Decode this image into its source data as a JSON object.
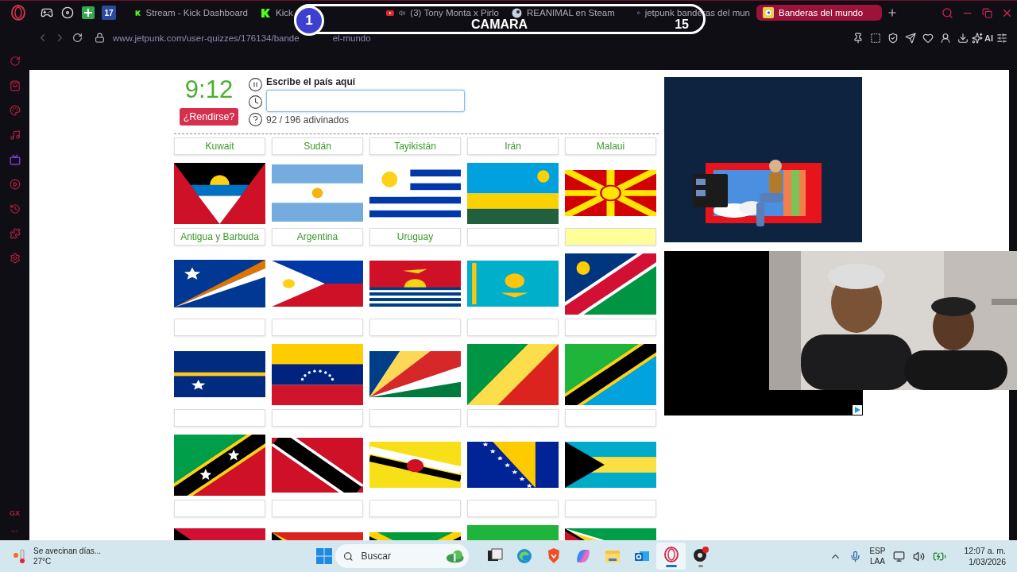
{
  "browser": {
    "pinned": [
      {
        "kind": "gamepad"
      },
      {
        "kind": "disc"
      },
      {
        "kind": "sheets"
      },
      {
        "kind": "calendar",
        "text": "17"
      }
    ],
    "tabs": [
      {
        "label": "Stream - Kick Dashboard",
        "kind": "kick",
        "audio": false,
        "selected": false
      },
      {
        "label": "Kick",
        "kind": "kick",
        "audio": false,
        "selected": false
      },
      {
        "label": "(3) Tony Monta x Pirlo",
        "kind": "youtube",
        "audio": true,
        "selected": false
      },
      {
        "label": "REANIMAL en Steam",
        "kind": "steam",
        "audio": false,
        "selected": false
      },
      {
        "label": "jetpunk banderas del mun",
        "kind": "google",
        "audio": false,
        "selected": false
      },
      {
        "label": "Banderas del mundo",
        "kind": "jetpunk",
        "audio": false,
        "selected": true
      }
    ],
    "url": "www.jetpunk.com/user-quizzes/176134/bande",
    "url_tail": "el-mundo",
    "toolbar": [
      {
        "kind": "pin"
      },
      {
        "kind": "snapshot"
      },
      {
        "kind": "shield"
      },
      {
        "kind": "send"
      },
      {
        "kind": "heart"
      },
      {
        "kind": "profile"
      },
      {
        "kind": "download"
      },
      {
        "kind": "ai",
        "label": "AI"
      },
      {
        "kind": "menu"
      }
    ]
  },
  "sidebar": {
    "items": [
      {
        "kind": "aria"
      },
      {
        "kind": "bag"
      },
      {
        "kind": "palette"
      },
      {
        "kind": "music"
      },
      {
        "kind": "twitch"
      },
      {
        "kind": "play"
      },
      {
        "kind": "history"
      },
      {
        "kind": "puzzle"
      },
      {
        "kind": "settings"
      }
    ],
    "badge": "GX",
    "more": "···"
  },
  "stream_overlay": {
    "left_score": "1",
    "title": "CAMARA",
    "right_score": "15"
  },
  "quiz": {
    "timer": "9:12",
    "give_up": "¿Rendirse?",
    "prompt": "Escribe el país aquí",
    "progress": "92 / 196 adivinados",
    "rows": [
      {
        "answers": [
          {
            "text": "Kuwait",
            "highlighted": false
          },
          {
            "text": "Sudán",
            "highlighted": false
          },
          {
            "text": "Tayikistán",
            "highlighted": false
          },
          {
            "text": "Irán",
            "highlighted": false
          },
          {
            "text": "Malaui",
            "highlighted": false
          }
        ]
      },
      {
        "flags": [
          {
            "kind": "antigua"
          },
          {
            "kind": "argentina"
          },
          {
            "kind": "uruguay"
          },
          {
            "kind": "rwanda"
          },
          {
            "kind": "macedonia"
          }
        ],
        "answers": [
          {
            "text": "Antigua y Barbuda",
            "highlighted": false
          },
          {
            "text": "Argentina",
            "highlighted": false
          },
          {
            "text": "Uruguay",
            "highlighted": false
          },
          {
            "highlighted": false
          },
          {
            "highlighted": true
          }
        ]
      },
      {
        "flags": [
          {
            "kind": "marshall"
          },
          {
            "kind": "philippines"
          },
          {
            "kind": "kiribati"
          },
          {
            "kind": "kazakhstan"
          },
          {
            "kind": "namibia"
          }
        ],
        "answers": [
          {
            "highlighted": false
          },
          {
            "highlighted": false
          },
          {
            "highlighted": false
          },
          {
            "highlighted": false
          },
          {
            "highlighted": false
          }
        ]
      },
      {
        "flags": [
          {
            "kind": "nauru"
          },
          {
            "kind": "venezuela"
          },
          {
            "kind": "seychelles"
          },
          {
            "kind": "congo"
          },
          {
            "kind": "tanzania"
          }
        ],
        "answers": [
          {
            "highlighted": false
          },
          {
            "highlighted": false
          },
          {
            "highlighted": false
          },
          {
            "highlighted": false
          },
          {
            "highlighted": false
          }
        ]
      },
      {
        "flags": [
          {
            "kind": "stkitts"
          },
          {
            "kind": "trinidad"
          },
          {
            "kind": "brunei"
          },
          {
            "kind": "bosnia"
          },
          {
            "kind": "bahamas"
          }
        ],
        "answers": [
          {
            "highlighted": false
          },
          {
            "highlighted": false
          },
          {
            "highlighted": false
          },
          {
            "highlighted": false
          },
          {
            "highlighted": false
          }
        ]
      },
      {
        "flags": [
          {
            "kind": "vanuatu"
          },
          {
            "kind": "timor"
          },
          {
            "kind": "jamaica"
          },
          {
            "kind": "sierraleone"
          },
          {
            "kind": "guyana"
          }
        ]
      }
    ]
  },
  "taskbar": {
    "weather": "Se avecinan días...",
    "temperature": "27°C",
    "search_placeholder": "Buscar",
    "apps": [
      {
        "kind": "taskview",
        "active": false,
        "running": false
      },
      {
        "kind": "edge",
        "active": false,
        "running": false
      },
      {
        "kind": "brave",
        "active": false,
        "running": false
      },
      {
        "kind": "copilot",
        "active": false,
        "running": false
      },
      {
        "kind": "files",
        "active": false,
        "running": false
      },
      {
        "kind": "outlook",
        "active": false,
        "running": false
      },
      {
        "kind": "opera",
        "active": true,
        "running": true
      },
      {
        "kind": "obs",
        "active": false,
        "running": true
      }
    ],
    "language": "ESP",
    "region": "LAA",
    "time": "12:07 a. m.",
    "date": "1/03/2026"
  }
}
